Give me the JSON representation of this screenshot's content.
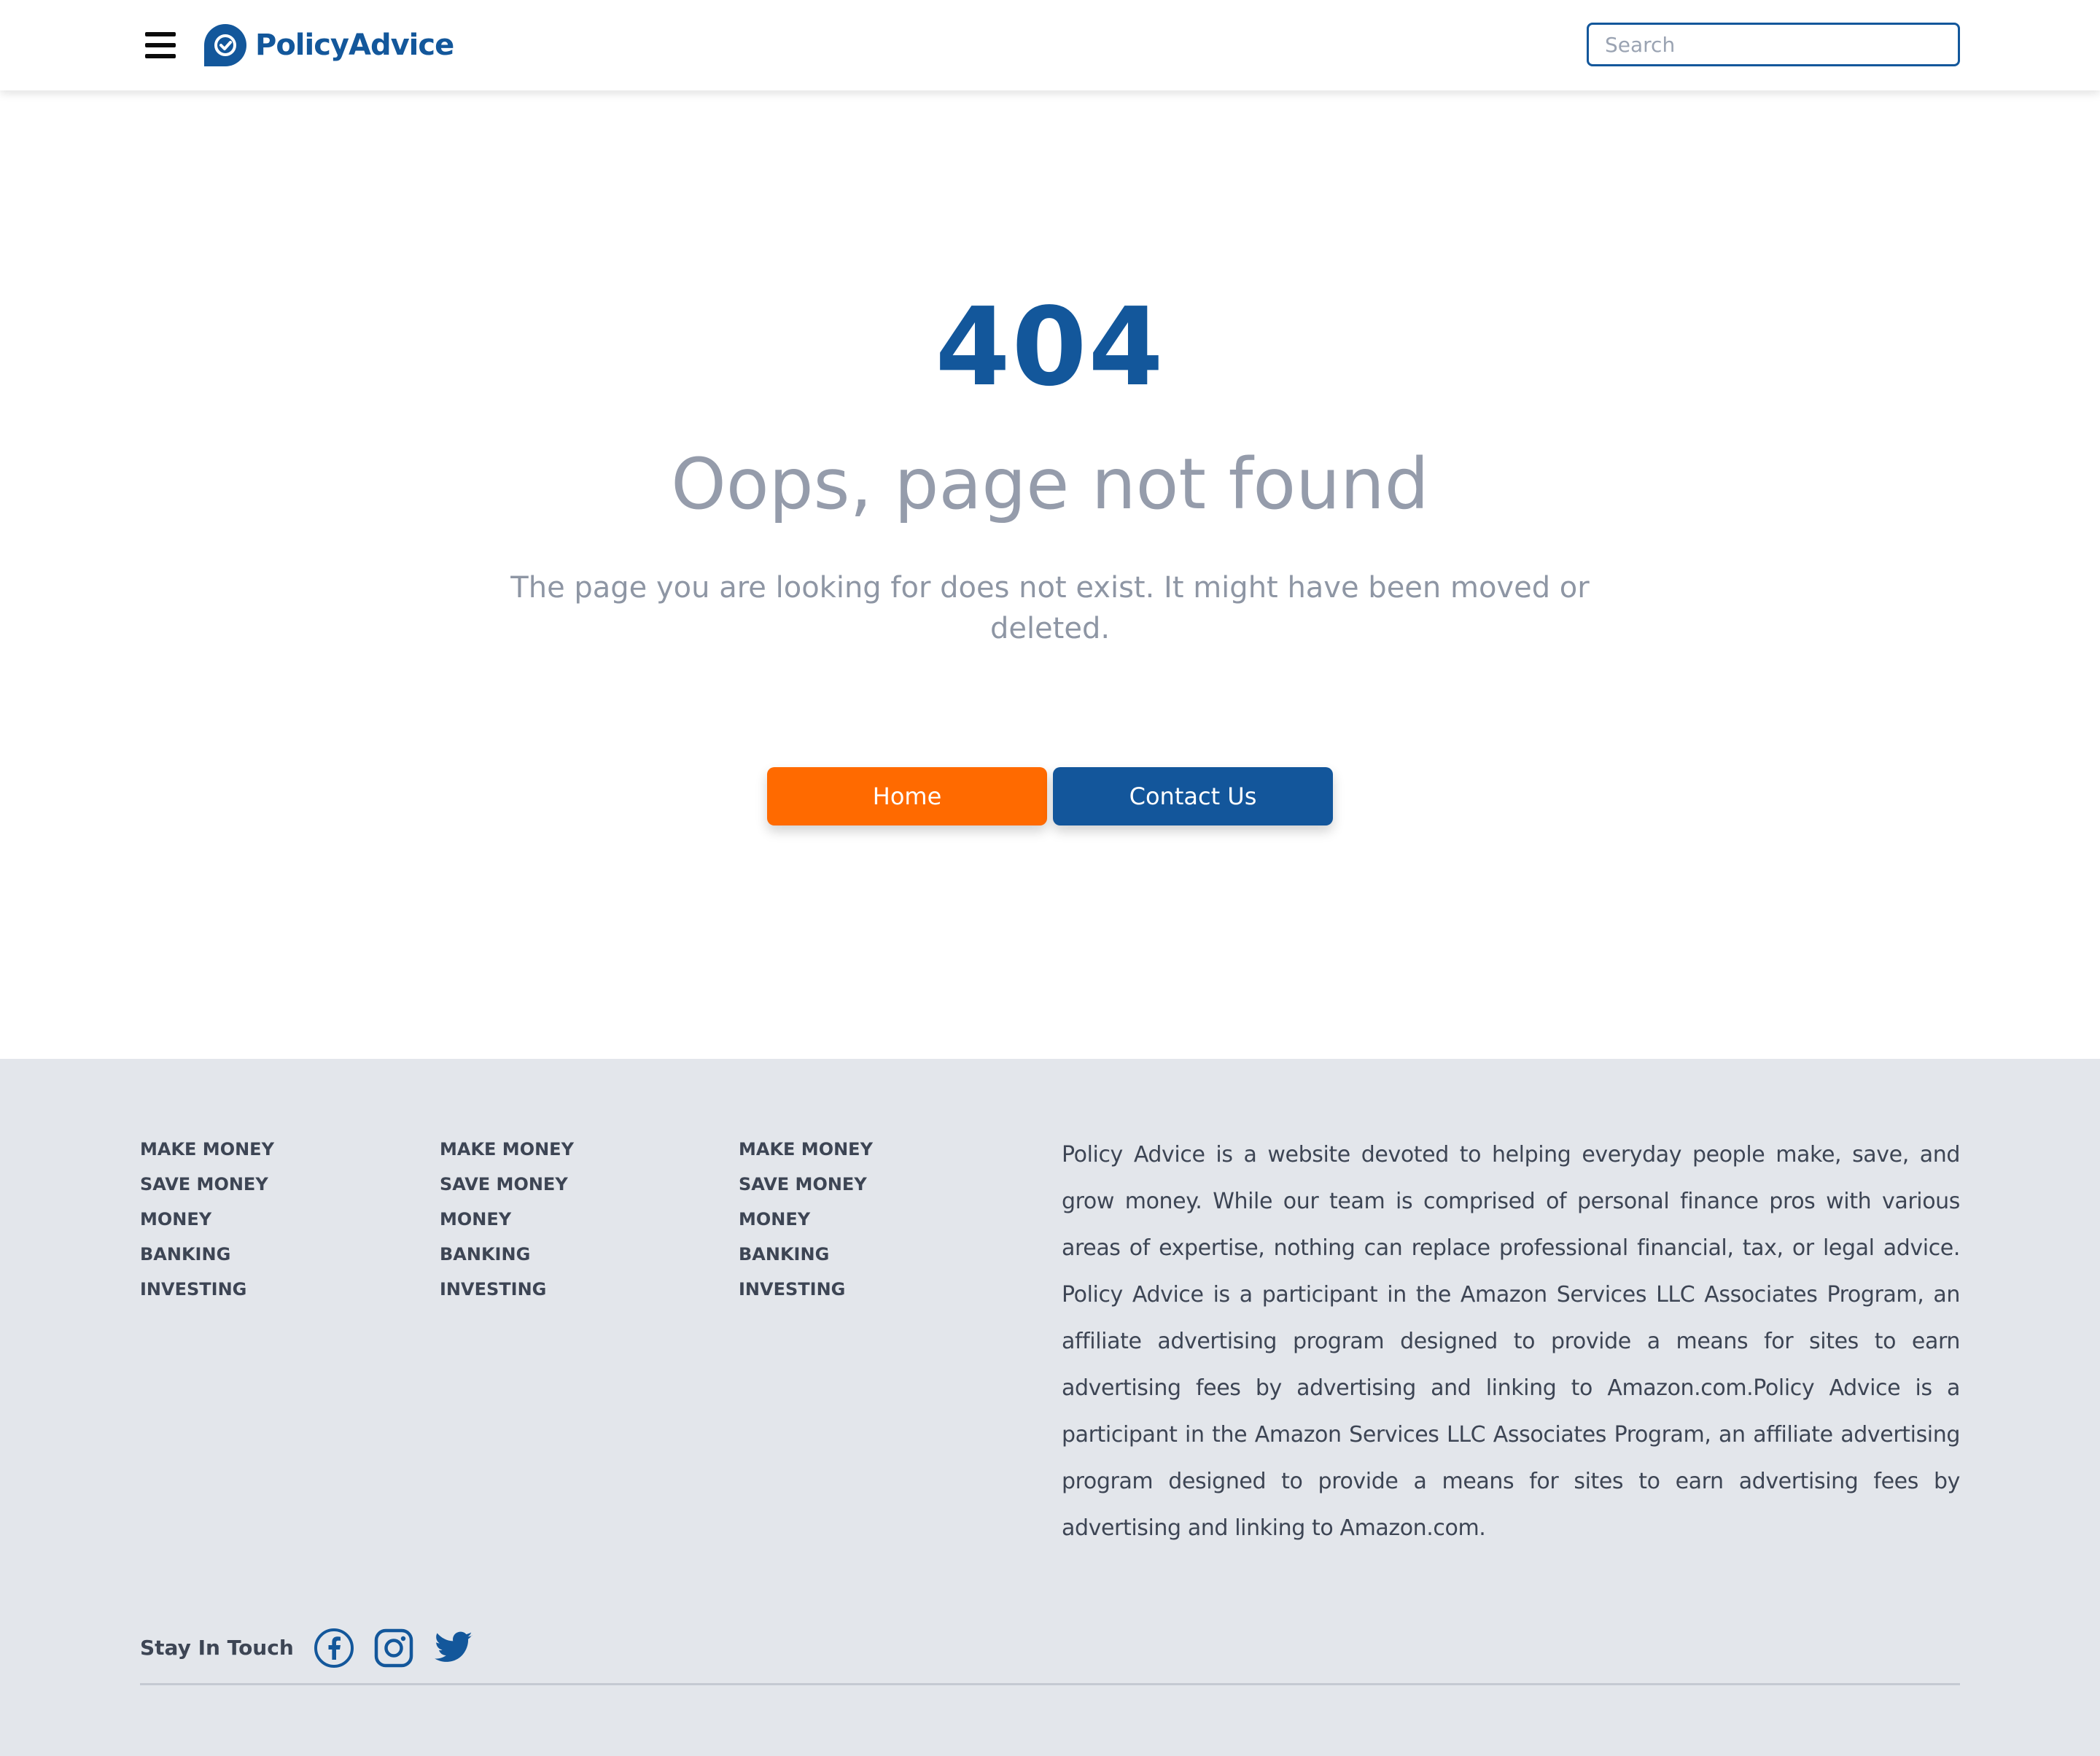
{
  "colors": {
    "brand_blue": "#13579b",
    "accent_orange": "#ff6a00",
    "footer_bg": "#e3e6eb",
    "muted_text": "#959cab"
  },
  "header": {
    "menu_icon": "hamburger-menu-icon",
    "logo_icon": "chat-bubble-check-icon",
    "logo_text": "PolicyAdvice",
    "search_placeholder": "Search"
  },
  "main": {
    "code": "404",
    "title": "Oops, page not found",
    "description": "The page you are looking for does not exist. It might have been moved or deleted.",
    "buttons": {
      "home": "Home",
      "contact": "Contact Us"
    }
  },
  "footer": {
    "columns": [
      [
        "MAKE MONEY",
        "SAVE MONEY",
        "MONEY",
        "BANKING",
        "INVESTING"
      ],
      [
        "MAKE MONEY",
        "SAVE MONEY",
        "MONEY",
        "BANKING",
        "INVESTING"
      ],
      [
        "MAKE MONEY",
        "SAVE MONEY",
        "MONEY",
        "BANKING",
        "INVESTING"
      ]
    ],
    "about": "Policy Advice is a website devoted to helping everyday people make, save, and grow money. While our team is comprised of personal finance pros with various areas of expertise, nothing can replace professional financial, tax, or legal advice. Policy Advice is a participant in the Amazon Services LLC Associates Program, an affiliate advertising program designed to provide a means for sites to earn advertising fees by advertising and linking to Amazon.com.Policy Advice is a participant in the Amazon Services LLC Associates Program, an affiliate advertising program designed to provide a means for sites to earn advertising fees by advertising and linking to Amazon.com.",
    "stay_in_touch": "Stay In Touch",
    "social_icons": [
      "facebook-icon",
      "instagram-icon",
      "twitter-icon"
    ]
  }
}
